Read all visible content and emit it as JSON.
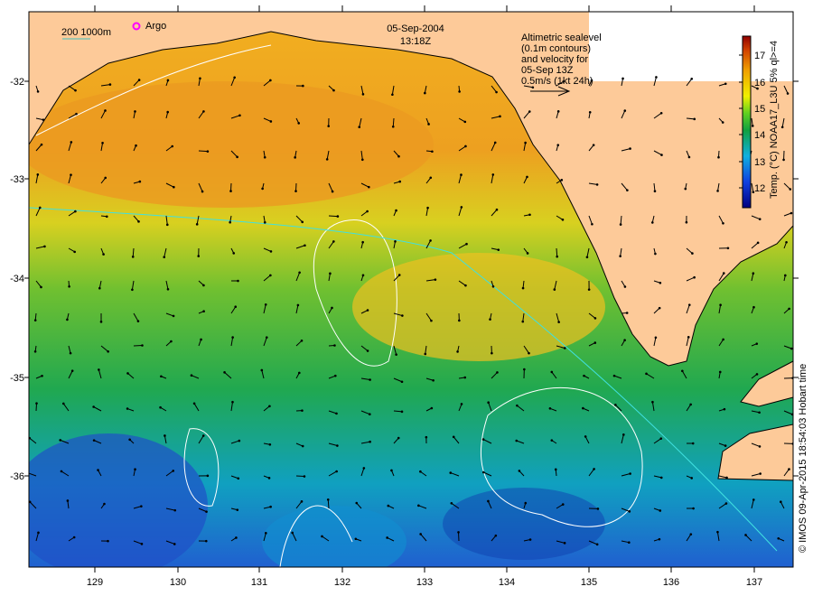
{
  "title": {
    "date": "05-Sep-2004",
    "time": "13:18Z"
  },
  "scale": {
    "label": "200  1000m"
  },
  "argo": {
    "label": "Argo",
    "color": "#ff00ff"
  },
  "legend": {
    "lines": [
      "Altimetric sealevel",
      "(0.1m contours)",
      "and velocity for",
      "05-Sep 13Z",
      "0.5m/s (1kt 24h)"
    ]
  },
  "colorbar": {
    "label": "Temp. (°C) NOAA17_L3U 5% ql>=4",
    "ticks": [
      "12",
      "13",
      "14",
      "15",
      "16",
      "17"
    ]
  },
  "credit": "© IMOS 09-Apr-2015 18:54:03 Hobart time",
  "axes": {
    "lat_ticks": [
      "-32",
      "-33",
      "-34",
      "-35",
      "-36"
    ],
    "lon_ticks": [
      "129",
      "130",
      "131",
      "132",
      "133",
      "134",
      "135",
      "136",
      "137"
    ]
  },
  "colors": {
    "land": "#fdca99",
    "warm": "#f0a020",
    "mid": "#20b040",
    "cold": "#1060d0"
  }
}
